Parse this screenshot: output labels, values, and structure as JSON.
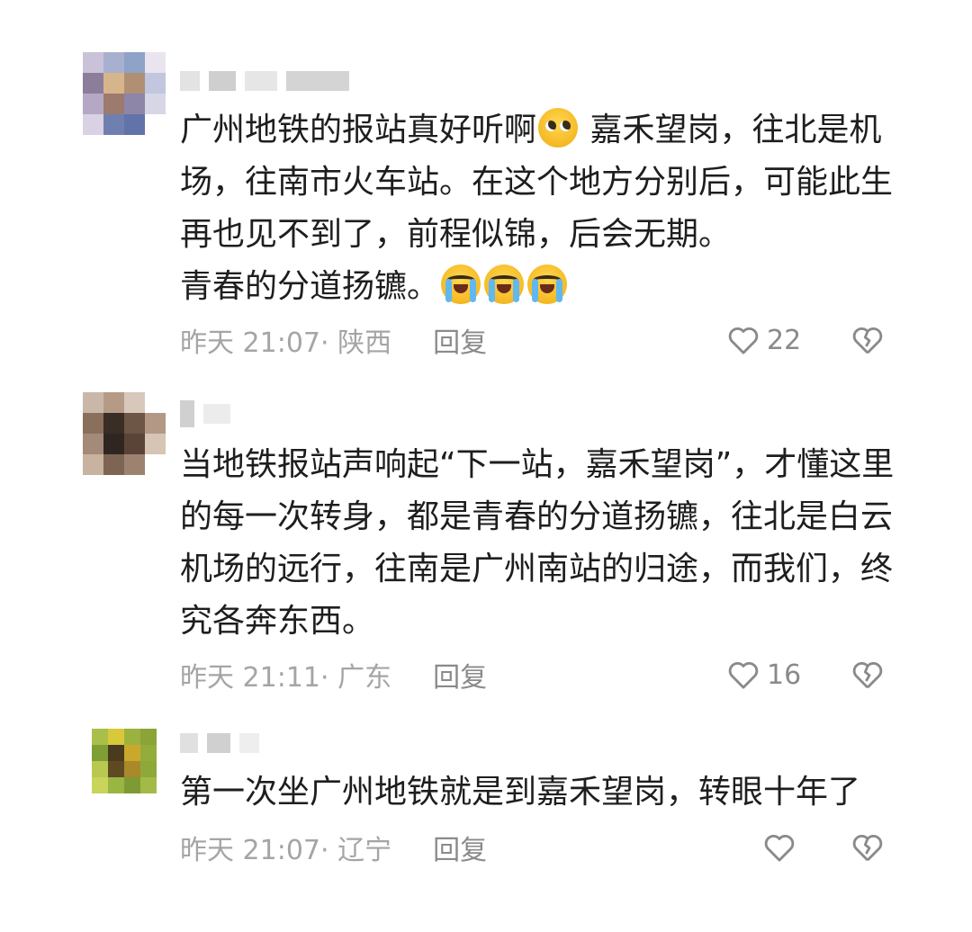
{
  "comments": [
    {
      "lines": [
        "广州地铁的报站真好听啊",
        "嘉禾望岗，往北是机",
        "场，往南市火车站。在这个地方分别后，可能此生",
        "再也见不到了，前程似锦，后会无期。",
        "青春的分道扬镳。"
      ],
      "emojis": [
        "pleading-face",
        "loudly-crying-face",
        "loudly-crying-face",
        "loudly-crying-face"
      ],
      "time": "昨天 21:07",
      "location": "· 陕西",
      "reply_label": "回复",
      "like_count": "22"
    },
    {
      "lines": [
        "当地铁报站声响起“下一站，嘉禾望岗”，才懂这里",
        "的每一次转身，都是青春的分道扬镳，往北是白云",
        "机场的远行，往南是广州南站的归途，而我们，终",
        "究各奔东西。"
      ],
      "time": "昨天 21:11",
      "location": "· 广东",
      "reply_label": "回复",
      "like_count": "16"
    },
    {
      "lines": [
        "第一次坐广州地铁就是到嘉禾望岗，转眼十年了"
      ],
      "time": "昨天 21:07",
      "location": "· 辽宁",
      "reply_label": "回复",
      "like_count": ""
    }
  ],
  "colors": {
    "text": "#1e1e1e",
    "meta": "#a5a5a5",
    "icon": "#8a8a8a"
  },
  "icons": {
    "like": "heart-outline-icon",
    "dislike": "broken-heart-icon"
  }
}
